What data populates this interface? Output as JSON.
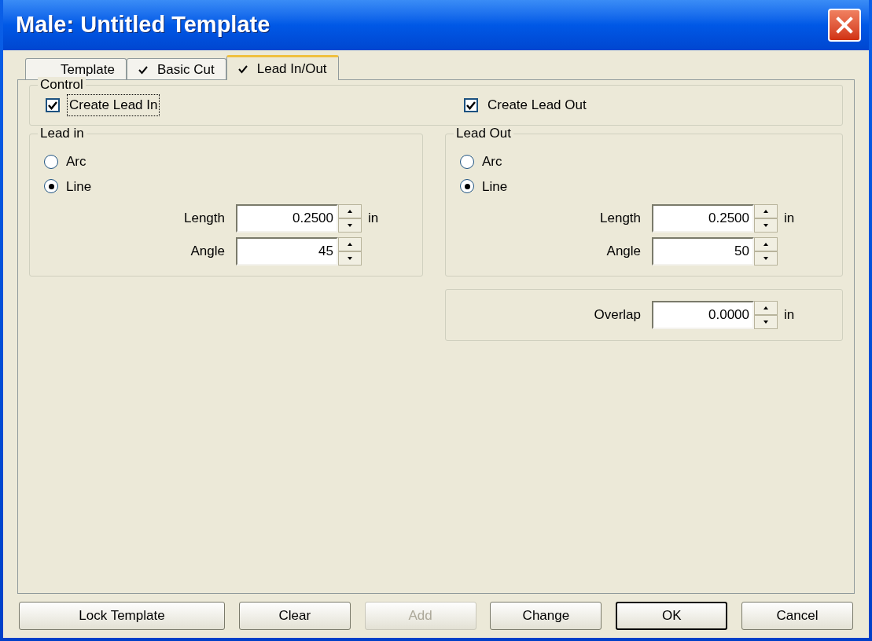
{
  "window": {
    "title": "Male: Untitled Template"
  },
  "tabs": [
    {
      "label": "Template",
      "checked": false,
      "selected": false
    },
    {
      "label": "Basic Cut",
      "checked": true,
      "selected": false
    },
    {
      "label": "Lead In/Out",
      "checked": true,
      "selected": true
    }
  ],
  "control": {
    "title": "Control",
    "checkboxes": [
      {
        "label": "Create Lead In",
        "checked": true,
        "focused": true
      },
      {
        "label": "Create Lead Out",
        "checked": true,
        "focused": false
      }
    ]
  },
  "groups": [
    {
      "title": "Lead in",
      "radios": [
        {
          "label": "Arc",
          "selected": false
        },
        {
          "label": "Line",
          "selected": true
        }
      ],
      "fields": [
        {
          "label": "Length",
          "value": "0.2500",
          "unit": "in"
        },
        {
          "label": "Angle",
          "value": "45"
        }
      ]
    },
    {
      "title": "Lead Out",
      "radios": [
        {
          "label": "Arc",
          "selected": false
        },
        {
          "label": "Line",
          "selected": true
        }
      ],
      "fields": [
        {
          "label": "Length",
          "value": "0.2500",
          "unit": "in"
        },
        {
          "label": "Angle",
          "value": "50"
        }
      ]
    }
  ],
  "overlap": {
    "label": "Overlap",
    "value": "0.0000",
    "unit": "in"
  },
  "buttons": [
    {
      "label": "Lock Template",
      "disabled": false,
      "default": false
    },
    {
      "label": "Clear",
      "disabled": false,
      "default": false
    },
    {
      "label": "Add",
      "disabled": true,
      "default": false
    },
    {
      "label": "Change",
      "disabled": false,
      "default": false
    },
    {
      "label": "OK",
      "disabled": false,
      "default": true
    },
    {
      "label": "Cancel",
      "disabled": false,
      "default": false
    }
  ]
}
